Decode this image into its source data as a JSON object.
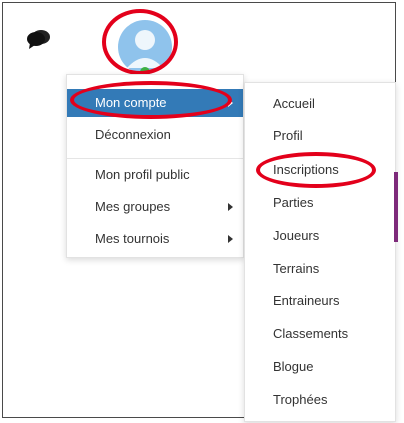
{
  "topbar": {
    "chat_icon": "chat-bubbles-icon",
    "avatar_icon": "user-avatar-icon",
    "status_color": "#3cb043"
  },
  "menu": {
    "items": [
      {
        "label": "Mon compte",
        "active": true,
        "has_submenu": true
      },
      {
        "label": "Déconnexion"
      },
      {
        "label": "Mon profil public"
      },
      {
        "label": "Mes groupes",
        "has_submenu": true
      },
      {
        "label": "Mes tournois",
        "has_submenu": true
      }
    ]
  },
  "submenu": {
    "items": [
      {
        "label": "Accueil"
      },
      {
        "label": "Profil"
      },
      {
        "label": "Inscriptions",
        "highlighted": true
      },
      {
        "label": "Parties"
      },
      {
        "label": "Joueurs"
      },
      {
        "label": "Terrains"
      },
      {
        "label": "Entraineurs"
      },
      {
        "label": "Classements"
      },
      {
        "label": "Blogue"
      },
      {
        "label": "Trophées"
      }
    ]
  },
  "colors": {
    "active_bg": "#337ab7",
    "annotation_red": "#e3001b",
    "accent_purple": "#7d2a7a"
  }
}
